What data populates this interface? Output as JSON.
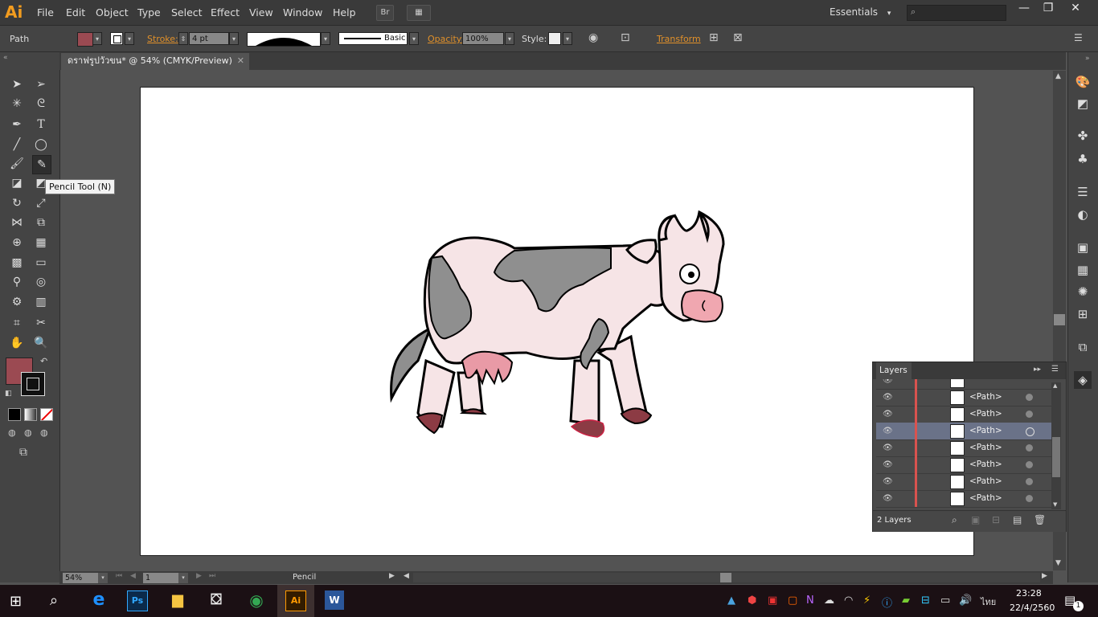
{
  "app": {
    "logo": "Ai",
    "accent": "#f29c1f"
  },
  "menu": [
    "File",
    "Edit",
    "Object",
    "Type",
    "Select",
    "Effect",
    "View",
    "Window",
    "Help"
  ],
  "menubar_buttons": {
    "bridge": "Br",
    "arrange": "▦"
  },
  "workspace": {
    "label": "Essentials",
    "arrow": "▾"
  },
  "window_controls": {
    "minimize": "—",
    "restore": "❐",
    "close": "✕"
  },
  "control": {
    "selection_label": "Path",
    "fill_color": "#9b4a52",
    "stroke_label": "Stroke:",
    "stroke_weight": "4 pt",
    "brush_label": "Basic",
    "opacity_label": "Opacity:",
    "opacity_value": "100%",
    "style_label": "Style:",
    "transform_label": "Transform"
  },
  "document": {
    "tab_title": "ดราฟรูปวัวขน* @ 54% (CMYK/Preview)",
    "close": "✕"
  },
  "tooltip": "Pencil Tool (N)",
  "layers_panel": {
    "title": "Layers",
    "rows": [
      {
        "name": "<Path>",
        "selected": false
      },
      {
        "name": "<Path>",
        "selected": false
      },
      {
        "name": "<Path>",
        "selected": true
      },
      {
        "name": "<Path>",
        "selected": false
      },
      {
        "name": "<Path>",
        "selected": false
      },
      {
        "name": "<Path>",
        "selected": false
      },
      {
        "name": "<Path>",
        "selected": false
      }
    ],
    "footer_count": "2 Layers"
  },
  "status": {
    "zoom": "54%",
    "artboard": "1",
    "tool": "Pencil"
  },
  "taskbar": {
    "time": "23:28",
    "date": "22/4/2560",
    "language": "ไทย",
    "notifications": "1"
  }
}
